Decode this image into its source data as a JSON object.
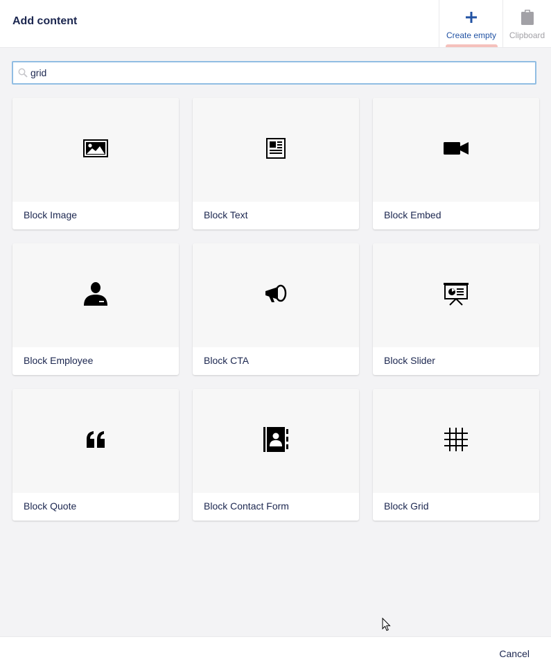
{
  "header": {
    "title": "Add content",
    "create_empty_label": "Create empty",
    "create_empty_icon": "plus-icon",
    "clipboard_label": "Clipboard",
    "clipboard_icon": "clipboard-icon"
  },
  "search": {
    "value": "grid",
    "icon": "search-icon"
  },
  "cards": [
    {
      "label": "Block Image",
      "icon": "picture-icon"
    },
    {
      "label": "Block Text",
      "icon": "newspaper-icon"
    },
    {
      "label": "Block Embed",
      "icon": "video-camera-icon"
    },
    {
      "label": "Block Employee",
      "icon": "employee-icon"
    },
    {
      "label": "Block CTA",
      "icon": "megaphone-icon"
    },
    {
      "label": "Block Slider",
      "icon": "presentation-icon"
    },
    {
      "label": "Block Quote",
      "icon": "quote-icon"
    },
    {
      "label": "Block Contact Form",
      "icon": "address-book-icon"
    },
    {
      "label": "Block Grid",
      "icon": "grid-icon"
    }
  ],
  "footer": {
    "cancel_label": "Cancel"
  },
  "colors": {
    "accent": "#2152a3",
    "text": "#1b264f",
    "active_indicator": "#f5c1bc",
    "search_border": "#90bde3",
    "background": "#f3f3f5"
  }
}
